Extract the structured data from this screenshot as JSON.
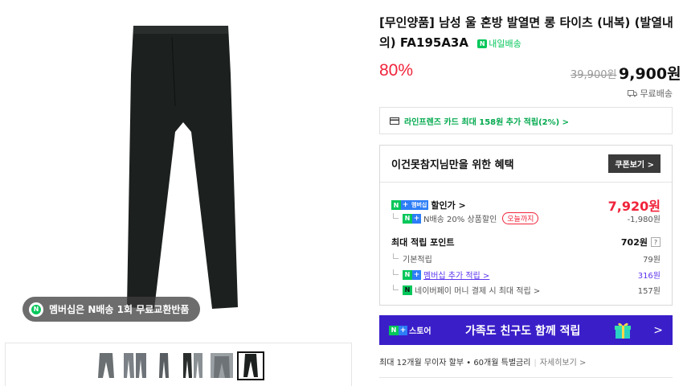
{
  "product": {
    "title": "[무인양품] 남성 울 혼방 발열면 롱 타이츠 (내복) (발열내의) FA195A3A",
    "delivery_badge": "내일배송",
    "discount": "80%",
    "original_price": "39,900원",
    "sale_price": "9,900원",
    "shipping": "무료배송"
  },
  "image": {
    "member_badge": "멤버십은 N배송 1회 무료교환반품",
    "thumbnails_count": 6
  },
  "card_promo": "라인프렌즈 카드 최대 158원 추가 적립(2%) >",
  "benefit": {
    "header": "이건못참지님만을 위한 혜택",
    "coupon_button": "쿠폰보기 >",
    "member_price_label": "할인가 >",
    "member_price": "7,920원",
    "member_badge_text": "멤버십",
    "n_delivery_label": "N배송 20% 상품할인",
    "until_today": "오늘까지",
    "n_delivery_amount": "-1,980원",
    "max_points_label": "최대 적립 포인트",
    "max_points": "702원",
    "help": "?",
    "base_label": "기본적립",
    "base_amount": "79원",
    "member_extra_label": "멤버십 추가 적립 >",
    "member_extra_amount": "316원",
    "naverpay_label": "네이버페이 머니 결제 시 최대 적립 >",
    "naverpay_amount": "157원"
  },
  "banner": {
    "store_label": "스토어",
    "title": "가족도 친구도 함께 적립",
    "arrow": ">"
  },
  "installment": {
    "text": "최대 12개월 무이자 할부 • 60개월 특별금리",
    "more": "자세히보기 >"
  },
  "colors": {
    "accent_red": "#f0233b",
    "naver_green": "#03c75a",
    "banner_purple": "#3a1fc9",
    "link_purple": "#5b34ef"
  },
  "icons": [
    "naver-n-icon",
    "card-icon",
    "truck-icon",
    "chevron-right-icon",
    "gift-icon"
  ]
}
